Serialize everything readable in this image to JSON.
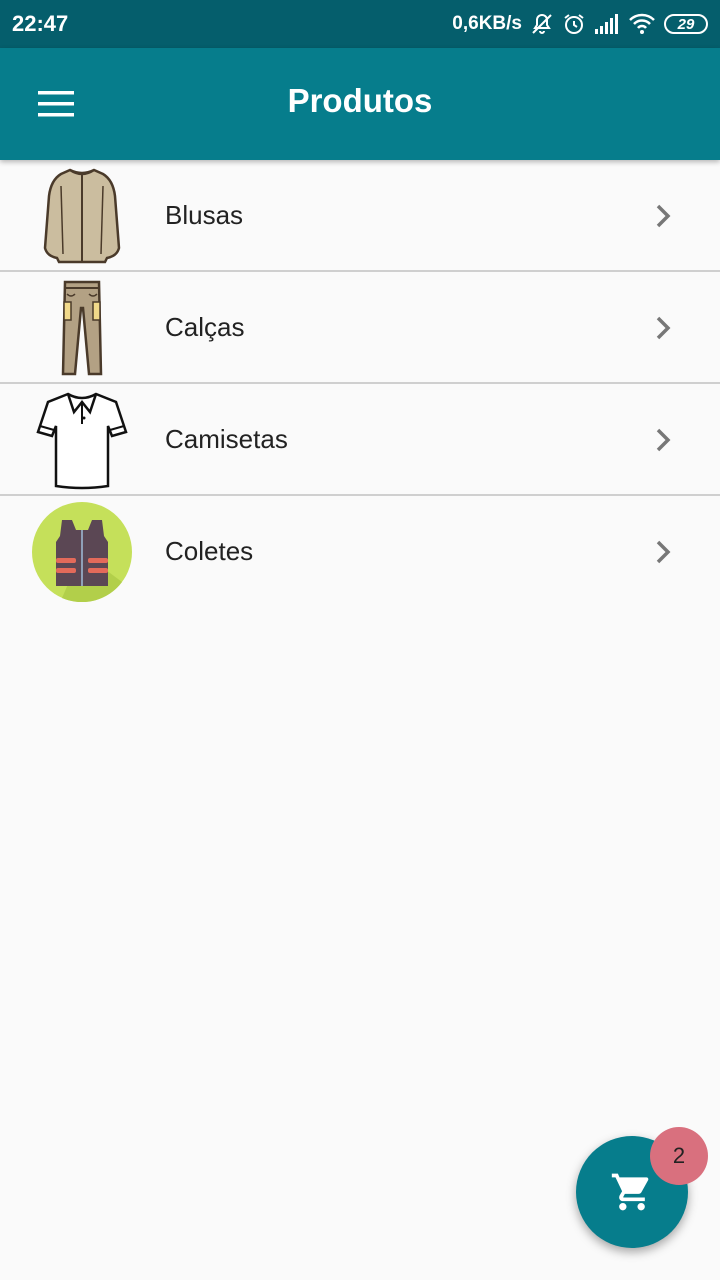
{
  "status_bar": {
    "time": "22:47",
    "network_speed": "0,6KB/s",
    "battery": "29",
    "icons": [
      "notifications-off-icon",
      "alarm-icon",
      "signal-icon",
      "wifi-icon",
      "battery-icon"
    ]
  },
  "app_bar": {
    "title": "Produtos",
    "menu_icon": "hamburger-menu-icon"
  },
  "categories": [
    {
      "label": "Blusas",
      "icon": "jacket-icon"
    },
    {
      "label": "Calças",
      "icon": "pants-icon"
    },
    {
      "label": "Camisetas",
      "icon": "polo-shirt-icon"
    },
    {
      "label": "Coletes",
      "icon": "vest-icon"
    }
  ],
  "cart": {
    "icon": "shopping-cart-icon",
    "count": "2"
  },
  "colors": {
    "status_bar": "#055e6c",
    "primary": "#067d8c",
    "badge": "#d9707e",
    "background": "#fafafa"
  }
}
